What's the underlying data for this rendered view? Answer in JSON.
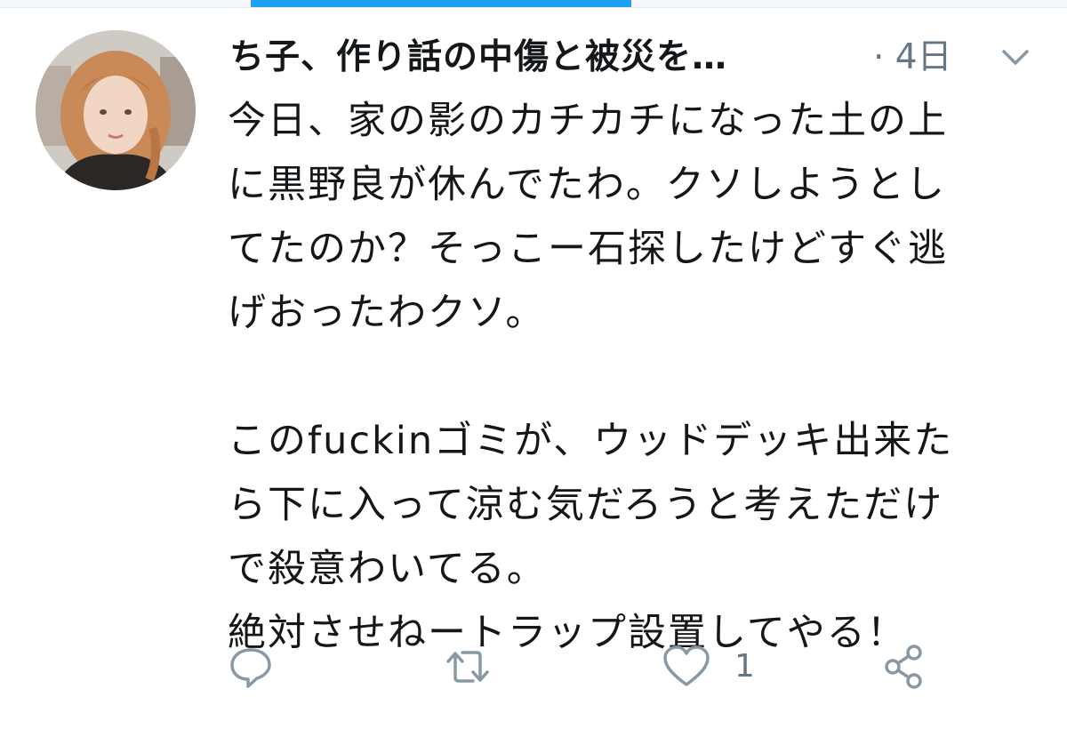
{
  "tweet": {
    "display_name": "ち子、作り話の中傷と被災を…",
    "timestamp": "· 4日",
    "text": "今日、家の影のカチカチになった土の上\nに黒野良が休んでたわ。クソしようとし\nてたのか？そっこー石探したけどすぐ逃\nげおったわクソ。\n\nこのfuckinゴミが、ウッドデッキ出来た\nら下に入って涼む気だろうと考えただけ\nで殺意わいてる。\n絶対させねートラップ設置してやる！",
    "like_count": "1"
  },
  "icons": {
    "menu": "chevron-down-icon",
    "reply": "reply-bubble-icon",
    "retweet": "retweet-icon",
    "like": "heart-icon",
    "share": "share-icon"
  },
  "colors": {
    "accent": "#1da1f2",
    "text": "#14171a",
    "secondary": "#657786"
  }
}
